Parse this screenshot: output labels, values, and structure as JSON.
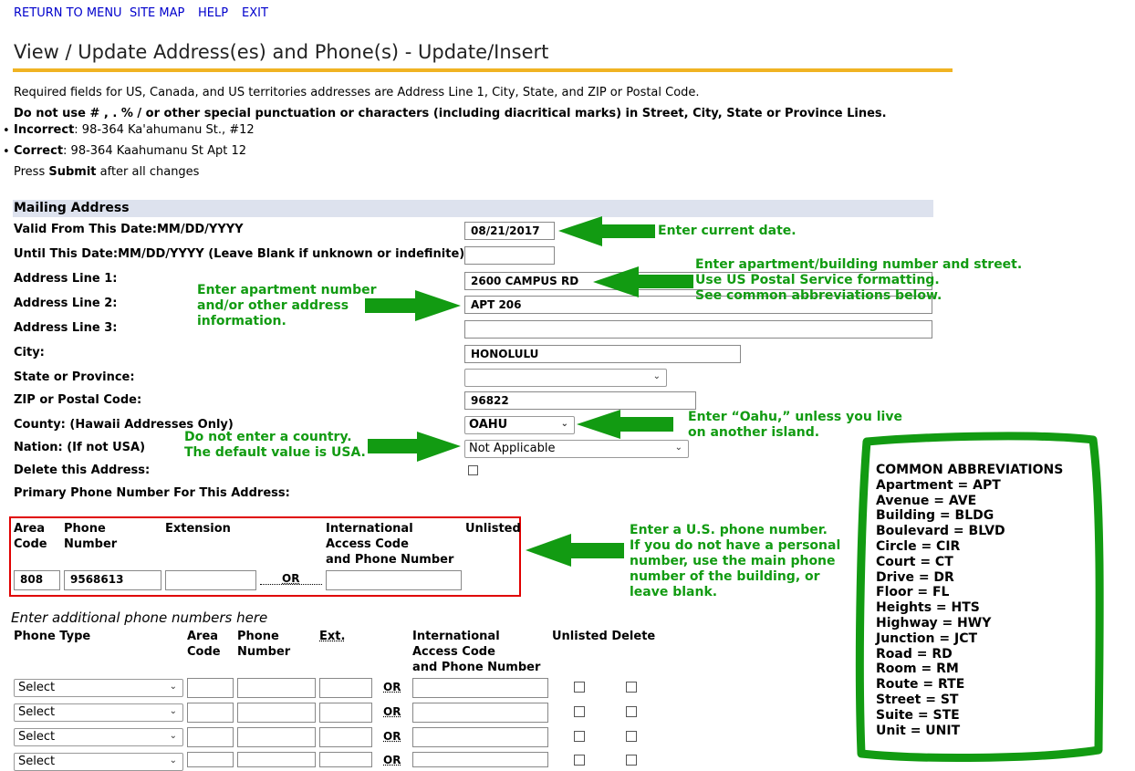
{
  "nav": {
    "return_to_menu": "RETURN TO MENU",
    "site_map": "SITE MAP",
    "help": "HELP",
    "exit": "EXIT"
  },
  "page_title": "View / Update Address(es) and Phone(s) - Update/Insert",
  "instructions": {
    "required": "Required fields for US, Canada, and US territories addresses are Address Line 1, City, State, and ZIP or Postal Code.",
    "no_punct": "Do not use # , . % / or other special punctuation or characters (including diacritical marks) in Street, City, State or Province Lines.",
    "incorrect_label": "Incorrect",
    "incorrect_value": ": 98-364 Ka'ahumanu St., #12",
    "correct_label": "Correct",
    "correct_value": ": 98-364 Kaahumanu St Apt 12",
    "press": "Press ",
    "submit_word": "Submit",
    "after": " after all changes"
  },
  "mailing": {
    "section_title": "Mailing Address",
    "valid_from_label": "Valid From This Date:MM/DD/YYYY",
    "valid_from_value": "08/21/2017",
    "until_label": "Until This Date:MM/DD/YYYY (Leave Blank if unknown or indefinite)",
    "until_value": "",
    "line1_label": "Address Line 1:",
    "line1_value": "2600 CAMPUS RD",
    "line2_label": "Address Line 2:",
    "line2_value": "APT 206",
    "line3_label": "Address Line 3:",
    "line3_value": "",
    "city_label": "City:",
    "city_value": "HONOLULU",
    "state_label": "State or Province:",
    "state_value": "",
    "zip_label": "ZIP or Postal Code:",
    "zip_value": "96822",
    "county_label": "County: (Hawaii Addresses Only)",
    "county_value": "OAHU",
    "nation_label": "Nation: (If not USA)",
    "nation_value": "Not Applicable",
    "delete_label": "Delete this Address:",
    "primary_phone_label": "Primary Phone Number For This Address:"
  },
  "primary_phone": {
    "col_area": "Area\nCode",
    "col_phone": "Phone\nNumber",
    "col_ext": "Extension",
    "col_intl": "International\nAccess Code\nand Phone Number",
    "col_unlisted": "Unlisted",
    "area_value": "808",
    "phone_value": "9568613",
    "ext_value": "",
    "or_text": "OR",
    "intl_value": ""
  },
  "additional": {
    "heading": "Enter additional phone numbers here",
    "col_type": "Phone Type",
    "col_area": "Area\nCode",
    "col_phone": "Phone\nNumber",
    "col_ext": "Ext.",
    "col_intl": "International\nAccess Code\nand Phone Number",
    "col_unlisted_delete": "Unlisted Delete",
    "rows": [
      {
        "type": "Select",
        "or": "OR"
      },
      {
        "type": "Select",
        "or": "OR"
      },
      {
        "type": "Select",
        "or": "OR"
      },
      {
        "type": "Select",
        "or": "OR"
      }
    ]
  },
  "callouts": {
    "current_date": "Enter current date.",
    "street": "Enter apartment/building number and street.\nUse US Postal Service formatting.\nSee common abbreviations below.",
    "apartment": "Enter apartment number\nand/or other address\ninformation.",
    "oahu": "Enter “Oahu,” unless you live\non another island.",
    "country": "Do not enter a country.\nThe default value is USA.",
    "phone": "Enter a U.S. phone number.\nIf you do not have a personal\nnumber, use the main phone\nnumber of the building, or\nleave blank."
  },
  "abbreviations": {
    "title": "COMMON ABBREVIATIONS",
    "items": [
      "Apartment = APT",
      "Avenue = AVE",
      "Building = BLDG",
      "Boulevard = BLVD",
      "Circle = CIR",
      "Court = CT",
      "Drive = DR",
      "Floor = FL",
      "Heights = HTS",
      "Highway = HWY",
      "Junction = JCT",
      "Road = RD",
      "Room = RM",
      "Route = RTE",
      "Street = ST",
      "Suite = STE",
      "Unit = UNIT"
    ]
  },
  "colors": {
    "callout_green": "#129b12",
    "rule_gold": "#f0b323",
    "link_blue": "#0000cc",
    "highlight_red": "#e00000"
  },
  "icons": [
    "chevron-down-icon",
    "arrow-left-icon",
    "arrow-right-icon"
  ]
}
